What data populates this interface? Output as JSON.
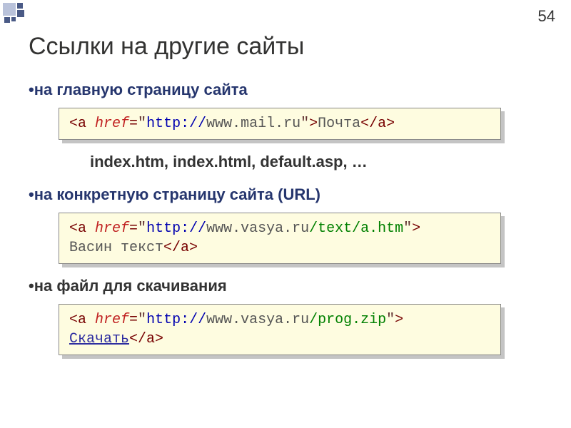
{
  "slide_number": "54",
  "title": "Ссылки на другие сайты",
  "bullets": {
    "b1": "•на главную страницу сайта",
    "b2": "•на конкретную страницу сайта (URL)",
    "b3": "•на файл для скачивания"
  },
  "index_note": "index.htm, index.html, default.asp, …",
  "code1": {
    "open": "<a ",
    "attr": "href",
    "eq": "=",
    "q1": "\"",
    "proto": "http://",
    "url": "www.mail.ru",
    "q2": "\"",
    "gt": ">",
    "text": "Почта",
    "close": "</a>"
  },
  "code2": {
    "open": "<a ",
    "attr": "href",
    "eq": "=",
    "q1": "\"",
    "proto": "http://",
    "host": "www.vasya.ru",
    "path": "/text/a.htm",
    "q2": "\"",
    "gt": ">",
    "text": "Васин текст",
    "close": "</a>"
  },
  "code3": {
    "open": "<a ",
    "attr": "href",
    "eq": "=",
    "q1": "\"",
    "proto": "http://",
    "host": "www.vasya.ru",
    "path": "/prog.zip",
    "q2": "\"",
    "gt": ">",
    "text": "Скачать",
    "close": "</a>"
  }
}
